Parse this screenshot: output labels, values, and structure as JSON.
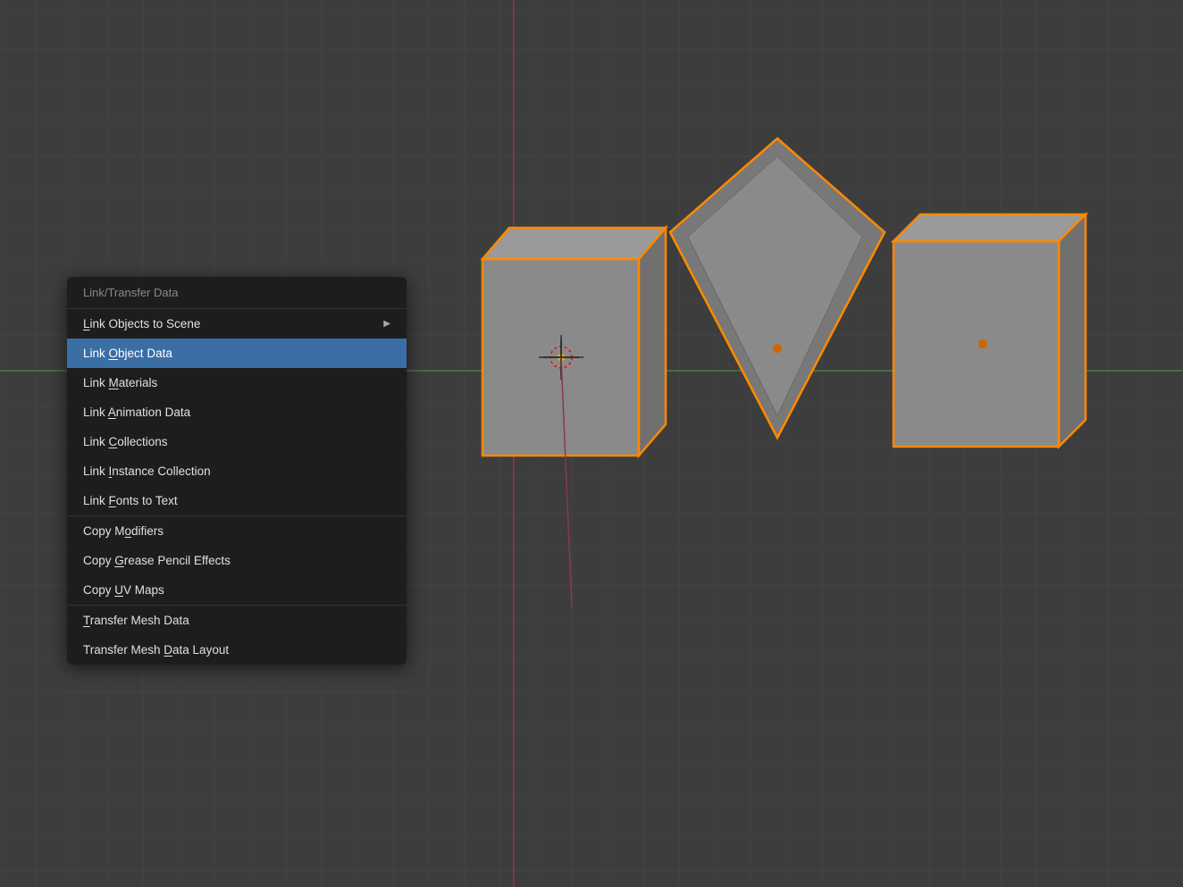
{
  "viewport": {
    "background_color": "#3d3d3d"
  },
  "context_menu": {
    "header": "Link/Transfer Data",
    "sections": [
      {
        "items": [
          {
            "id": "link-objects-to-scene",
            "label": "Link Objects to Scene",
            "shortcut_char": "L",
            "shortcut_index": 0,
            "has_arrow": true,
            "active": false
          },
          {
            "id": "link-object-data",
            "label": "Link Object Data",
            "shortcut_char": "O",
            "shortcut_index": 5,
            "has_arrow": false,
            "active": true
          },
          {
            "id": "link-materials",
            "label": "Link Materials",
            "shortcut_char": "M",
            "shortcut_index": 5,
            "has_arrow": false,
            "active": false
          },
          {
            "id": "link-animation-data",
            "label": "Link Animation Data",
            "shortcut_char": "A",
            "shortcut_index": 5,
            "has_arrow": false,
            "active": false
          },
          {
            "id": "link-collections",
            "label": "Link Collections",
            "shortcut_char": "C",
            "shortcut_index": 5,
            "has_arrow": false,
            "active": false
          },
          {
            "id": "link-instance-collection",
            "label": "Link Instance Collection",
            "shortcut_char": "I",
            "shortcut_index": 5,
            "has_arrow": false,
            "active": false
          },
          {
            "id": "link-fonts-to-text",
            "label": "Link Fonts to Text",
            "shortcut_char": "F",
            "shortcut_index": 5,
            "has_arrow": false,
            "active": false
          }
        ]
      },
      {
        "items": [
          {
            "id": "copy-modifiers",
            "label": "Copy Modifiers",
            "shortcut_char": "o",
            "shortcut_index": 5,
            "has_arrow": false,
            "active": false
          },
          {
            "id": "copy-grease-pencil",
            "label": "Copy Grease Pencil Effects",
            "shortcut_char": "G",
            "shortcut_index": 5,
            "has_arrow": false,
            "active": false
          },
          {
            "id": "copy-uv-maps",
            "label": "Copy UV Maps",
            "shortcut_char": "U",
            "shortcut_index": 5,
            "has_arrow": false,
            "active": false
          }
        ]
      },
      {
        "items": [
          {
            "id": "transfer-mesh-data",
            "label": "Transfer Mesh Data",
            "shortcut_char": "T",
            "shortcut_index": 0,
            "has_arrow": false,
            "active": false
          },
          {
            "id": "transfer-mesh-data-layout",
            "label": "Transfer Mesh Data Layout",
            "shortcut_char": "D",
            "shortcut_index": 14,
            "has_arrow": false,
            "active": false
          }
        ]
      }
    ]
  }
}
